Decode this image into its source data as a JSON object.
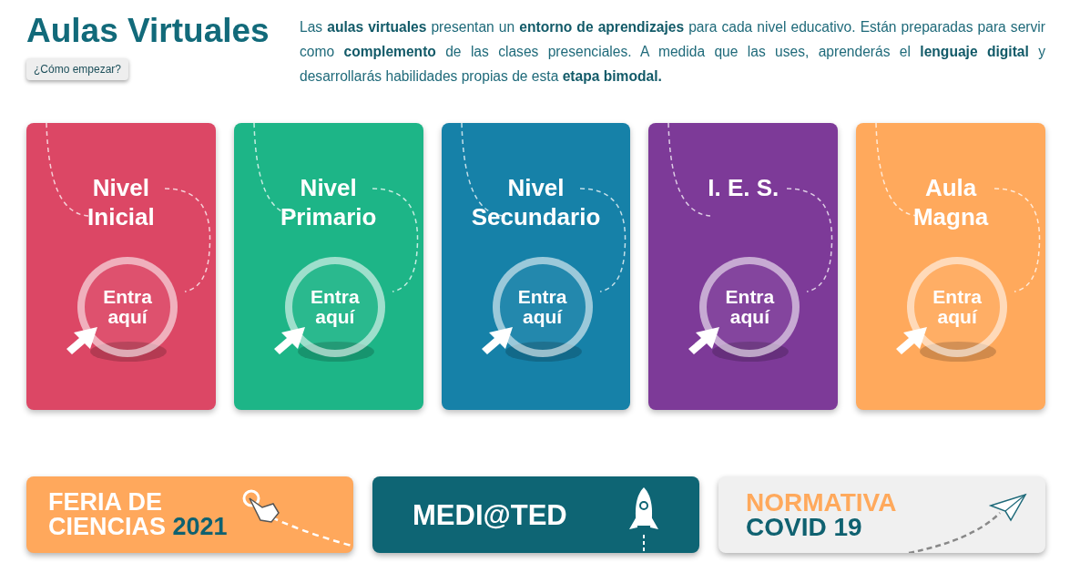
{
  "header": {
    "title": "Aulas Virtuales",
    "help_button": "¿Cómo empezar?",
    "intro": "Las **aulas virtuales** presentan un **entorno de aprendizajes** para cada nivel educativo. Están preparadas para servir como **complemento** de las clases presenciales. A medida que las uses, aprenderás el **lenguaje digital** y desarrollarás habilidades propias de esta **etapa bimodal.**"
  },
  "levels": [
    {
      "title": [
        "Nivel",
        "Inicial"
      ],
      "button": [
        "Entra",
        "aquí"
      ],
      "color": "#dc4765"
    },
    {
      "title": [
        "Nivel",
        "Primario"
      ],
      "button": [
        "Entra",
        "aquí"
      ],
      "color": "#1db587"
    },
    {
      "title": [
        "Nivel",
        "Secundario"
      ],
      "button": [
        "Entra",
        "aquí"
      ],
      "color": "#1681a8"
    },
    {
      "title": [
        "I. E. S."
      ],
      "button": [
        "Entra",
        "aquí"
      ],
      "color": "#7d3a98"
    },
    {
      "title": [
        "Aula",
        "Magna"
      ],
      "button": [
        "Entra",
        "aquí"
      ],
      "color": "#ffa95c"
    }
  ],
  "banners": [
    {
      "kind": "feria",
      "lines": [
        [
          {
            "text": "FERIA DE",
            "color": "#ffffff"
          }
        ],
        [
          {
            "text": "CIENCIAS ",
            "color": "#ffffff"
          },
          {
            "text": "2021",
            "color": "#0f6170"
          }
        ]
      ]
    },
    {
      "kind": "mediated",
      "lines": [
        [
          {
            "text": "MEDI@TED",
            "color": "#ffffff"
          }
        ]
      ]
    },
    {
      "kind": "covid",
      "lines": [
        [
          {
            "text": "NORMATIVA",
            "color": "#ffa95c"
          }
        ],
        [
          {
            "text": "COVID 19",
            "color": "#0f6170"
          }
        ]
      ]
    }
  ]
}
